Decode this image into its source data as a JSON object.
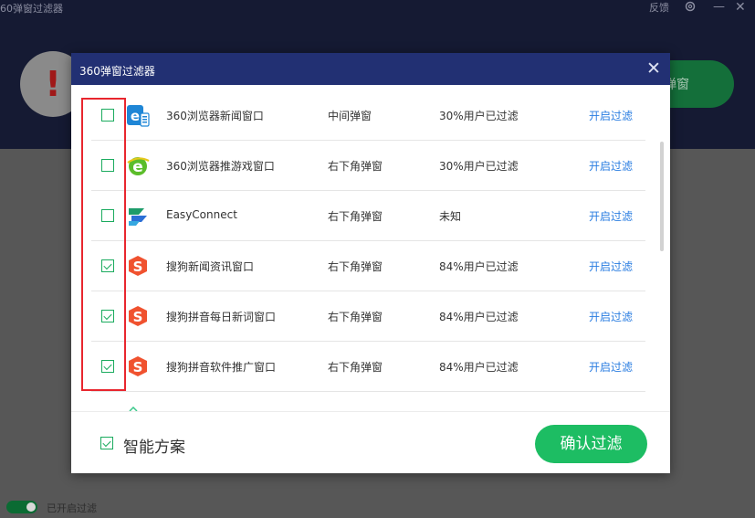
{
  "background": {
    "app_title": "60弹窗过滤器",
    "feedback_label": "反馈",
    "minimize_glyph": "—",
    "close_glyph": "✕",
    "alert_glyph": "!",
    "green_button_label": "弹窗",
    "toggle_label": "已开启过滤",
    "icons": {
      "gear": "gear-icon",
      "alert": "warning-icon"
    }
  },
  "modal": {
    "title": "360弹窗过滤器",
    "close_glyph": "✕",
    "rows": [
      {
        "name": "360浏览器新闻窗口",
        "type": "中间弹窗",
        "stat": "30%用户已过滤",
        "action": "开启过滤",
        "checked": false,
        "icon": "ie-browser-icon"
      },
      {
        "name": "360浏览器推游戏窗口",
        "type": "右下角弹窗",
        "stat": "30%用户已过滤",
        "action": "开启过滤",
        "checked": false,
        "icon": "360-browser-icon"
      },
      {
        "name": "EasyConnect",
        "type": "右下角弹窗",
        "stat": "未知",
        "action": "开启过滤",
        "checked": false,
        "icon": "easyconnect-icon"
      },
      {
        "name": "搜狗新闻资讯窗口",
        "type": "右下角弹窗",
        "stat": "84%用户已过滤",
        "action": "开启过滤",
        "checked": true,
        "icon": "sogou-icon"
      },
      {
        "name": "搜狗拼音每日新词窗口",
        "type": "右下角弹窗",
        "stat": "84%用户已过滤",
        "action": "开启过滤",
        "checked": true,
        "icon": "sogou-icon"
      },
      {
        "name": "搜狗拼音软件推广窗口",
        "type": "右下角弹窗",
        "stat": "84%用户已过滤",
        "action": "开启过滤",
        "checked": true,
        "icon": "sogou-icon"
      }
    ],
    "footer": {
      "smart_label": "智能方案",
      "smart_checked": true,
      "confirm_label": "确认过滤"
    }
  },
  "colors": {
    "header": "#223073",
    "accent_green": "#1dbd63",
    "link_blue": "#2a7de1",
    "highlight_red": "#e8262e",
    "bg_dark": "#151a33"
  }
}
